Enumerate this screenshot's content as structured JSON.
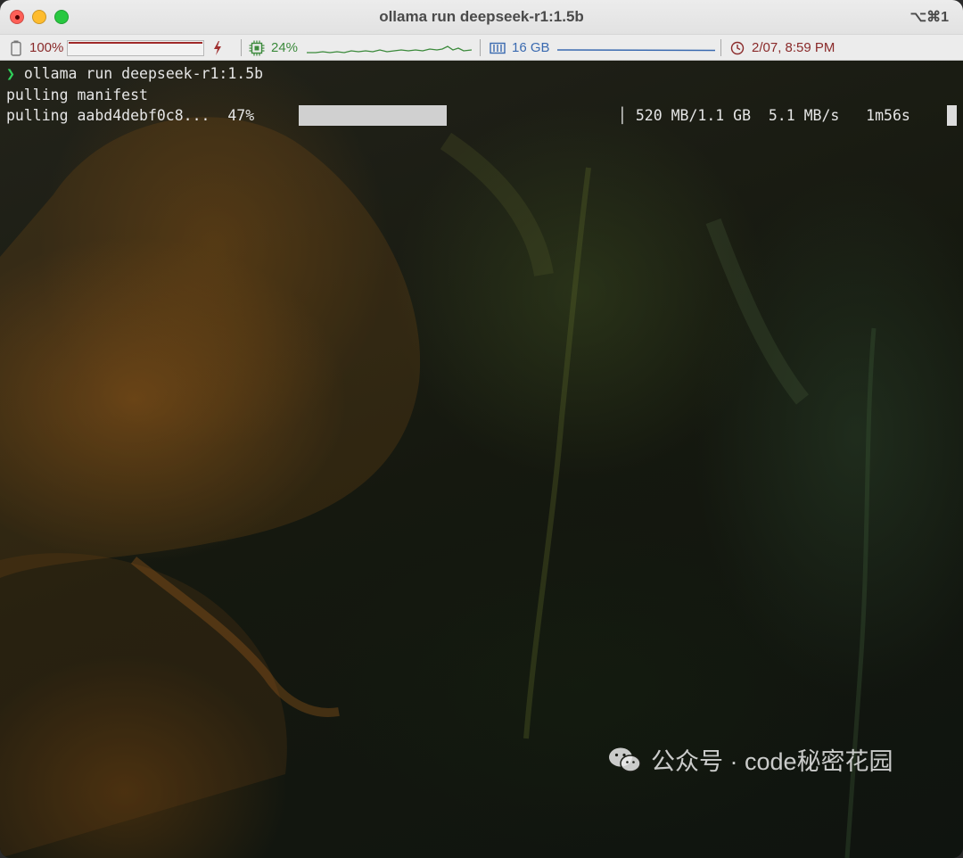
{
  "window": {
    "title": "ollama run deepseek-r1:1.5b",
    "shortcut": "⌥⌘1"
  },
  "statusbar": {
    "battery_label": "100%",
    "cpu_label": "24%",
    "memory_label": "16 GB",
    "clock_label": "2/07, 8:59 PM"
  },
  "terminal": {
    "prompt_symbol": "❯",
    "command": "ollama run deepseek-r1:1.5b",
    "line2": "pulling manifest",
    "line3_prefix": "pulling aabd4debf0c8...  47%",
    "progress_fraction": 0.47,
    "line3_suffix": "│ 520 MB/1.1 GB  5.1 MB/s   1m56s"
  },
  "watermark": {
    "text": "公众号 · code秘密花园"
  },
  "colors": {
    "prompt": "#2fd05a",
    "battery": "#8a2a2a",
    "cpu": "#3b8a3b",
    "memory": "#3a6ab0"
  }
}
